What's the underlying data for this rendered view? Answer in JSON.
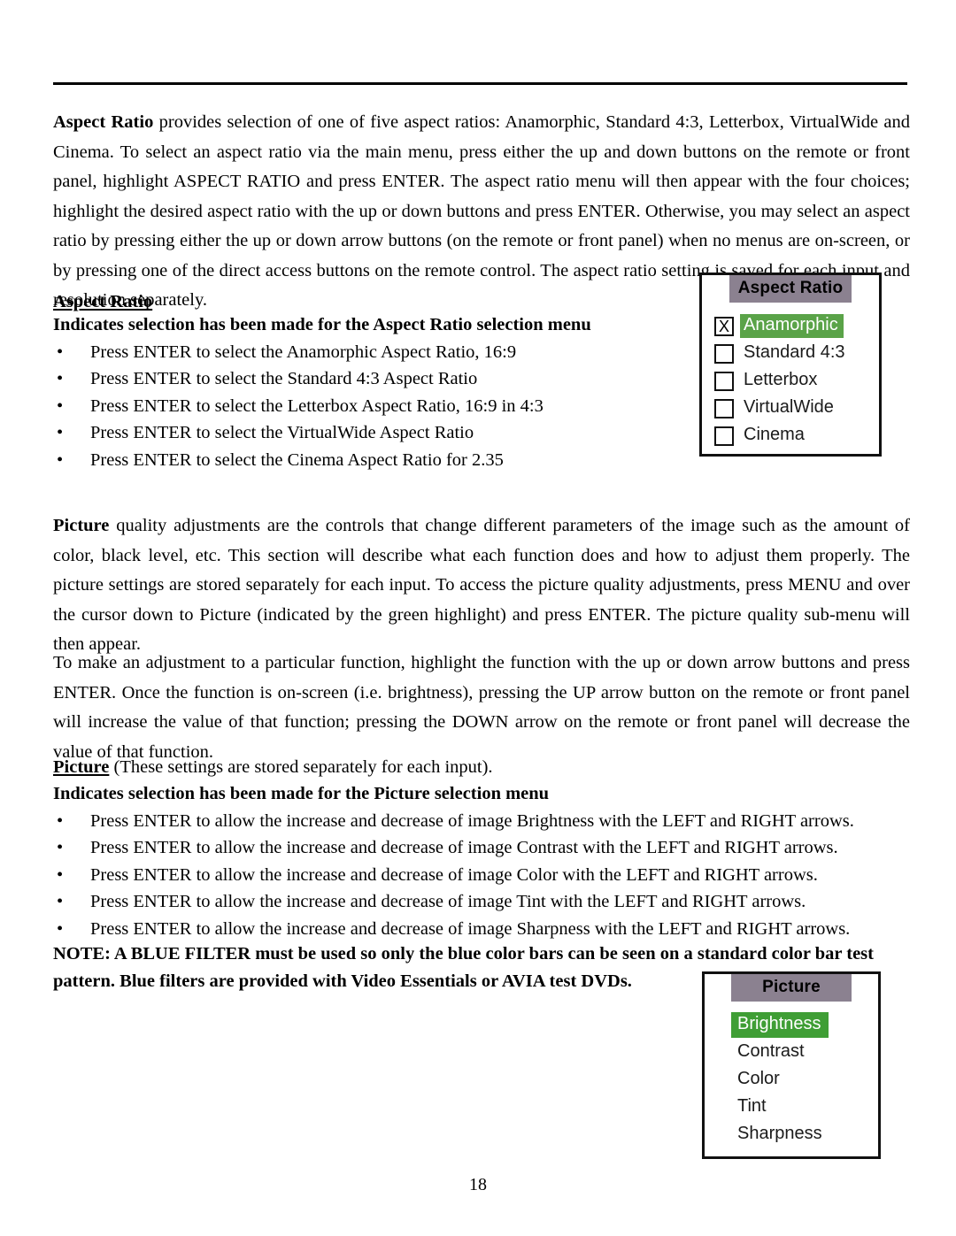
{
  "page": {
    "number": "18"
  },
  "paragraphs": {
    "aspect_intro_lead": "Aspect Ratio",
    "aspect_intro_rest": " provides selection of one of five aspect ratios: Anamorphic, Standard 4:3, Letterbox, VirtualWide and Cinema. To select an aspect ratio via the main menu, press either the up and down buttons on the remote or front panel, highlight ASPECT RATIO and press ENTER. The aspect ratio menu will then appear with the four choices; highlight the desired aspect ratio with the up or down buttons and press ENTER. Otherwise, you may select an aspect ratio by pressing either the up or down arrow buttons (on the remote or front panel) when no menus are on-screen, or by pressing one of the direct access buttons on the remote control. The aspect ratio setting is saved for each input and resolution separately.",
    "picture_intro_lead": "Picture",
    "picture_intro_rest": " quality adjustments  are the controls that change different parameters of the image such as the amount of color, black level, etc. This section will describe what each function does and how to adjust them properly. The picture settings are stored separately for each input. To access the picture quality adjustments, press MENU and over the cursor down to Picture (indicated by the green highlight) and press ENTER. The picture quality sub-menu will then appear.",
    "adjustment": "To make an adjustment to a particular function, highlight the function with the up or down arrow buttons and press ENTER. Once the function is on-screen (i.e. brightness), pressing the UP arrow button on the remote or front panel will increase the value of that function; pressing the DOWN arrow on the remote or front panel will decrease the value of that function."
  },
  "aspect_section": {
    "heading": "Aspect Ratio",
    "subheading": "Indicates selection has been made for the Aspect Ratio selection menu",
    "bullet_char": "•",
    "bullets": [
      "Press ENTER to select the Anamorphic Aspect Ratio, 16:9",
      "Press ENTER to select the Standard 4:3 Aspect Ratio",
      "Press ENTER to select the Letterbox Aspect Ratio, 16:9 in 4:3",
      "Press ENTER to select the VirtualWide Aspect Ratio",
      "Press ENTER to select the Cinema Aspect Ratio for 2.35"
    ]
  },
  "picture_section": {
    "heading_underlined": "Picture",
    "heading_rest": " (These settings are stored separately for each input).",
    "subheading": "Indicates selection has been made for the Picture selection menu",
    "bullet_char": "•",
    "bullets": [
      "Press ENTER to allow the increase and decrease of image Brightness with the LEFT and RIGHT arrows.",
      "Press ENTER to allow the increase and decrease of image Contrast with the LEFT and RIGHT arrows.",
      "Press ENTER to allow the increase and decrease of image Color with the LEFT and RIGHT arrows.",
      "Press ENTER to allow the increase and decrease of image Tint with the LEFT and RIGHT arrows.",
      "Press ENTER to allow the increase and decrease of image Sharpness with the LEFT and RIGHT arrows."
    ]
  },
  "note": {
    "text": "NOTE: A BLUE FILTER must be used so only the blue color bars can be seen on a standard color bar test pattern. Blue filters are provided with Video Essentials or AVIA test DVDs."
  },
  "osd_aspect_ratio": {
    "title": "Aspect Ratio",
    "title_bg": "#8b8190",
    "highlight_bg": "#5aa348",
    "checked_mark": "X",
    "items": [
      {
        "label": "Anamorphic",
        "checked": true,
        "mark": "X",
        "highlighted": true
      },
      {
        "label": "Standard 4:3",
        "checked": false,
        "mark": "",
        "highlighted": false
      },
      {
        "label": "Letterbox",
        "checked": false,
        "mark": "",
        "highlighted": false
      },
      {
        "label": "VirtualWide",
        "checked": false,
        "mark": "",
        "highlighted": false
      },
      {
        "label": "Cinema",
        "checked": false,
        "mark": "",
        "highlighted": false
      }
    ]
  },
  "osd_picture": {
    "title": "Picture",
    "title_bg": "#8b8190",
    "highlight_bg": "#3f9e35",
    "items": [
      {
        "label": "Brightness",
        "highlighted": true
      },
      {
        "label": "Contrast",
        "highlighted": false
      },
      {
        "label": "Color",
        "highlighted": false
      },
      {
        "label": "Tint",
        "highlighted": false
      },
      {
        "label": "Sharpness",
        "highlighted": false
      }
    ]
  }
}
